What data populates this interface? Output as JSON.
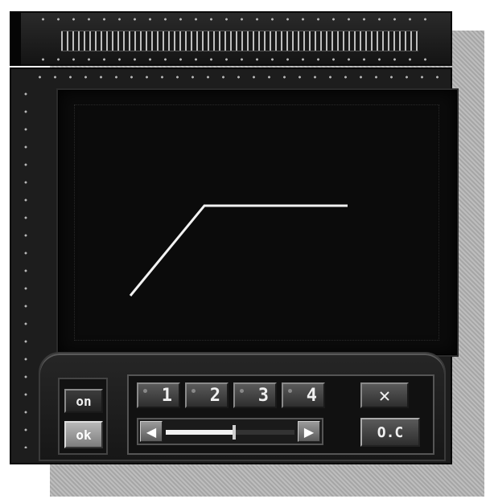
{
  "controls": {
    "power_label": "on",
    "ok_label": "ok",
    "channels": [
      "1",
      "2",
      "3",
      "4"
    ],
    "close_label": "✕",
    "oc_label": "O.C",
    "slider_left_arrow": "◀",
    "slider_right_arrow": "▶",
    "slider_level": 0.53
  },
  "colors": {
    "panel": "#1d1d1d",
    "screen": "#0b0b0b",
    "trace": "#f2f2f2"
  }
}
